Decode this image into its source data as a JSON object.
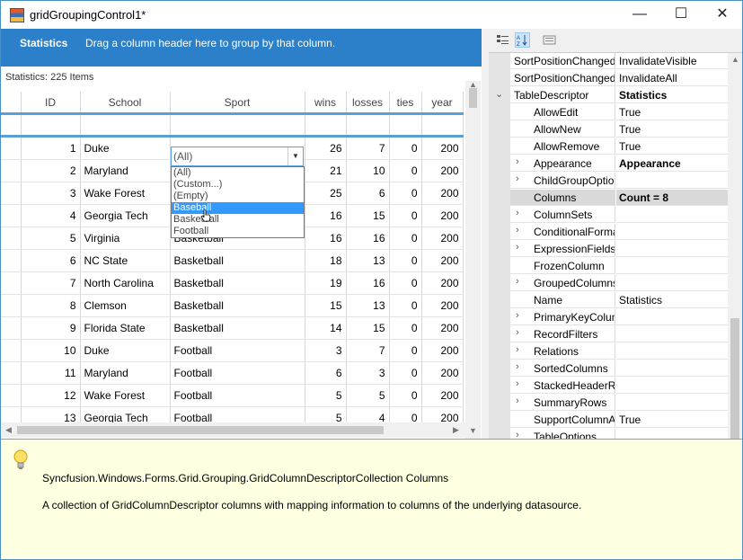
{
  "window": {
    "title": "gridGroupingControl1*",
    "min_glyph": "—",
    "max_glyph": "☐",
    "close_glyph": "✕"
  },
  "grid": {
    "caption_title": "Statistics",
    "caption_hint": "Drag a column header here to group by that column.",
    "stats_line": "Statistics: 225 Items",
    "columns": [
      "ID",
      "School",
      "Sport",
      "wins",
      "losses",
      "ties",
      "year"
    ],
    "rows": [
      [
        "1",
        "Duke",
        "",
        "26",
        "7",
        "0",
        "200"
      ],
      [
        "2",
        "Maryland",
        "",
        "21",
        "10",
        "0",
        "200"
      ],
      [
        "3",
        "Wake Forest",
        "",
        "25",
        "6",
        "0",
        "200"
      ],
      [
        "4",
        "Georgia Tech",
        "Basketball",
        "16",
        "15",
        "0",
        "200"
      ],
      [
        "5",
        "Virginia",
        "Basketball",
        "16",
        "16",
        "0",
        "200"
      ],
      [
        "6",
        "NC State",
        "Basketball",
        "18",
        "13",
        "0",
        "200"
      ],
      [
        "7",
        "North Carolina",
        "Basketball",
        "19",
        "16",
        "0",
        "200"
      ],
      [
        "8",
        "Clemson",
        "Basketball",
        "15",
        "13",
        "0",
        "200"
      ],
      [
        "9",
        "Florida State",
        "Basketball",
        "14",
        "15",
        "0",
        "200"
      ],
      [
        "10",
        "Duke",
        "Football",
        "3",
        "7",
        "0",
        "200"
      ],
      [
        "11",
        "Maryland",
        "Football",
        "6",
        "3",
        "0",
        "200"
      ],
      [
        "12",
        "Wake Forest",
        "Football",
        "5",
        "5",
        "0",
        "200"
      ],
      [
        "13",
        "Georgia Tech",
        "Football",
        "5",
        "4",
        "0",
        "200"
      ]
    ],
    "filter_value": "(All)",
    "dropdown_options": [
      "(All)",
      "(Custom...)",
      "(Empty)",
      "Baseball",
      "Basketball",
      "Football"
    ],
    "dropdown_selected_index": 3
  },
  "properties": {
    "rows": [
      {
        "name": "SortPositionChanged",
        "value": "InvalidateVisible",
        "indent": 0,
        "expander": "",
        "bold": false,
        "selected": false
      },
      {
        "name": "SortPositionChanged",
        "value": "InvalidateAll",
        "indent": 0,
        "expander": "",
        "bold": false,
        "selected": false
      },
      {
        "name": "TableDescriptor",
        "value": "Statistics",
        "indent": 0,
        "expander": "expanded",
        "bold": true,
        "selected": false
      },
      {
        "name": "AllowEdit",
        "value": "True",
        "indent": 1,
        "expander": "",
        "bold": false,
        "selected": false
      },
      {
        "name": "AllowNew",
        "value": "True",
        "indent": 1,
        "expander": "",
        "bold": false,
        "selected": false
      },
      {
        "name": "AllowRemove",
        "value": "True",
        "indent": 1,
        "expander": "",
        "bold": false,
        "selected": false
      },
      {
        "name": "Appearance",
        "value": "Appearance",
        "indent": 1,
        "expander": "collapsed",
        "bold": true,
        "selected": false
      },
      {
        "name": "ChildGroupOptions",
        "value": "",
        "indent": 1,
        "expander": "collapsed",
        "bold": false,
        "selected": false
      },
      {
        "name": "Columns",
        "value": "Count = 8",
        "indent": 1,
        "expander": "collapsed",
        "bold": true,
        "selected": true
      },
      {
        "name": "ColumnSets",
        "value": "",
        "indent": 1,
        "expander": "collapsed",
        "bold": false,
        "selected": false
      },
      {
        "name": "ConditionalFormats",
        "value": "",
        "indent": 1,
        "expander": "collapsed",
        "bold": false,
        "selected": false
      },
      {
        "name": "ExpressionFields",
        "value": "",
        "indent": 1,
        "expander": "collapsed",
        "bold": false,
        "selected": false
      },
      {
        "name": "FrozenColumn",
        "value": "",
        "indent": 1,
        "expander": "",
        "bold": false,
        "selected": false
      },
      {
        "name": "GroupedColumns",
        "value": "",
        "indent": 1,
        "expander": "collapsed",
        "bold": false,
        "selected": false
      },
      {
        "name": "Name",
        "value": "Statistics",
        "indent": 1,
        "expander": "",
        "bold": false,
        "selected": false
      },
      {
        "name": "PrimaryKeyColumns",
        "value": "",
        "indent": 1,
        "expander": "collapsed",
        "bold": false,
        "selected": false
      },
      {
        "name": "RecordFilters",
        "value": "",
        "indent": 1,
        "expander": "collapsed",
        "bold": false,
        "selected": false
      },
      {
        "name": "Relations",
        "value": "",
        "indent": 1,
        "expander": "collapsed",
        "bold": false,
        "selected": false
      },
      {
        "name": "SortedColumns",
        "value": "",
        "indent": 1,
        "expander": "collapsed",
        "bold": false,
        "selected": false
      },
      {
        "name": "StackedHeaderRows",
        "value": "",
        "indent": 1,
        "expander": "collapsed",
        "bold": false,
        "selected": false
      },
      {
        "name": "SummaryRows",
        "value": "",
        "indent": 1,
        "expander": "collapsed",
        "bold": false,
        "selected": false
      },
      {
        "name": "SupportColumnAlias",
        "value": "True",
        "indent": 1,
        "expander": "",
        "bold": false,
        "selected": false
      },
      {
        "name": "TableOptions",
        "value": "",
        "indent": 1,
        "expander": "collapsed",
        "bold": false,
        "selected": false
      }
    ]
  },
  "description": {
    "title": "Syncfusion.Windows.Forms.Grid.Grouping.GridColumnDescriptorCollection Columns",
    "text": "A collection of GridColumnDescriptor columns with mapping information to columns of the underlying datasource."
  }
}
